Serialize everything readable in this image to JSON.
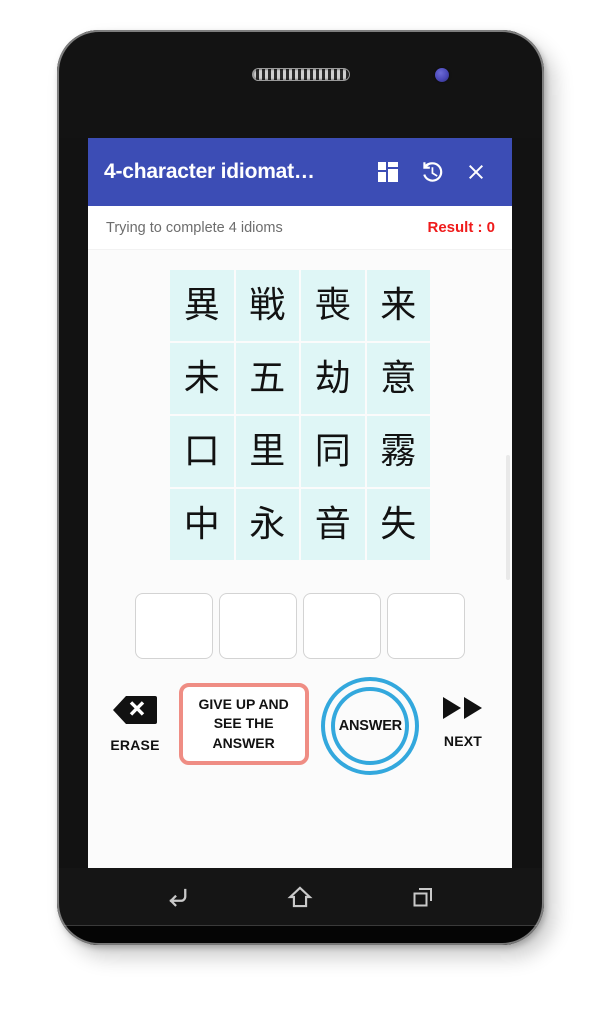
{
  "app_bar": {
    "title": "4-character idiomat…",
    "icons": [
      {
        "name": "dashboard-icon",
        "label": "Dashboard"
      },
      {
        "name": "history-icon",
        "label": "History"
      },
      {
        "name": "close-icon",
        "label": "Close"
      }
    ]
  },
  "status": {
    "message": "Trying to complete 4 idioms",
    "result_label": "Result : 0"
  },
  "grid": {
    "rows": 4,
    "cols": 4,
    "cells": [
      "異",
      "戦",
      "喪",
      "来",
      "未",
      "五",
      "劫",
      "意",
      "口",
      "里",
      "同",
      "霧",
      "中",
      "永",
      "音",
      "失"
    ]
  },
  "answer_slots": [
    "",
    "",
    "",
    ""
  ],
  "actions": {
    "erase": {
      "label": "ERASE",
      "icon": "backspace-icon"
    },
    "give_up": {
      "label": "GIVE UP AND SEE THE ANSWER"
    },
    "answer": {
      "label": "ANSWER"
    },
    "next": {
      "label": "NEXT",
      "icon": "fast-forward-icon"
    }
  },
  "nav_bar": {
    "back": "back-icon",
    "home": "home-icon",
    "recents": "recents-icon"
  },
  "colors": {
    "app_bar_blue": "#3c4db5",
    "result_red": "#ef1b1b",
    "tile_cyan": "#dff6f6",
    "give_up_border": "#ef8d84",
    "answer_blue": "#33a8dd"
  }
}
